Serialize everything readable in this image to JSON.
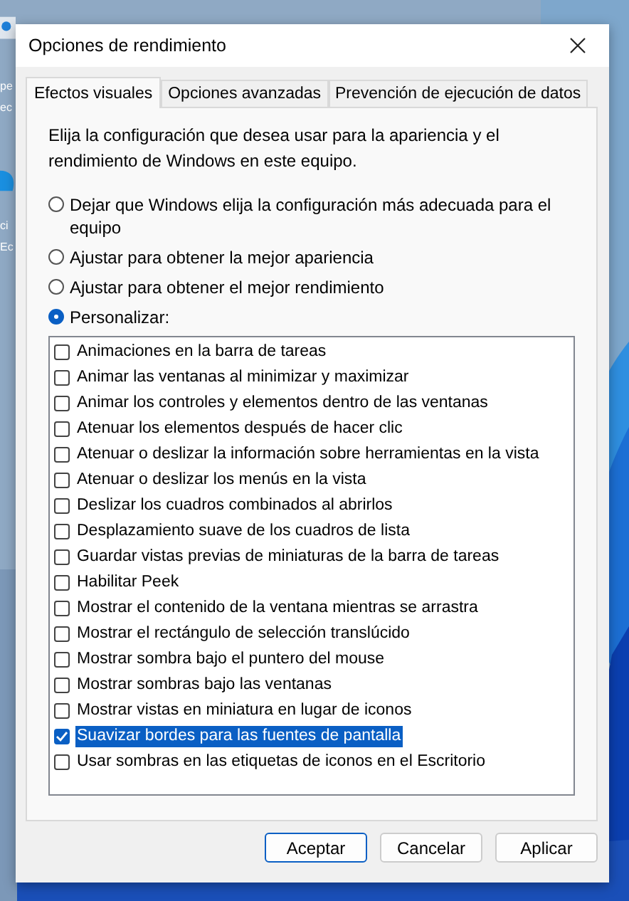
{
  "desktop_icons": [
    {
      "label_lines": [
        "pe",
        "ec"
      ]
    },
    {
      "label_lines": [
        "ci",
        "Ec"
      ]
    }
  ],
  "window": {
    "title": "Opciones de rendimiento"
  },
  "tabs": [
    {
      "label": "Efectos visuales",
      "selected": true
    },
    {
      "label": "Opciones avanzadas",
      "selected": false
    },
    {
      "label": "Prevención de ejecución de datos",
      "selected": false
    }
  ],
  "description": "Elija la configuración que desea usar para la apariencia y el rendimiento de Windows en este equipo.",
  "options": [
    {
      "label": "Dejar que Windows elija la configuración más adecuada para el equipo",
      "selected": false
    },
    {
      "label": "Ajustar para obtener la mejor apariencia",
      "selected": false
    },
    {
      "label": "Ajustar para obtener el mejor rendimiento",
      "selected": false
    },
    {
      "label": "Personalizar:",
      "selected": true
    }
  ],
  "effects": [
    {
      "label": "Animaciones en la barra de tareas",
      "checked": false,
      "selected": false
    },
    {
      "label": "Animar las ventanas al minimizar y maximizar",
      "checked": false,
      "selected": false
    },
    {
      "label": "Animar los controles y elementos dentro de las ventanas",
      "checked": false,
      "selected": false
    },
    {
      "label": "Atenuar los elementos después de hacer clic",
      "checked": false,
      "selected": false
    },
    {
      "label": "Atenuar o deslizar la información sobre herramientas en la vista",
      "checked": false,
      "selected": false
    },
    {
      "label": "Atenuar o deslizar los menús en la vista",
      "checked": false,
      "selected": false
    },
    {
      "label": "Deslizar los cuadros combinados al abrirlos",
      "checked": false,
      "selected": false
    },
    {
      "label": "Desplazamiento suave de los cuadros de lista",
      "checked": false,
      "selected": false
    },
    {
      "label": "Guardar vistas previas de miniaturas de la barra de tareas",
      "checked": false,
      "selected": false
    },
    {
      "label": "Habilitar Peek",
      "checked": false,
      "selected": false
    },
    {
      "label": "Mostrar el contenido de la ventana mientras se arrastra",
      "checked": false,
      "selected": false
    },
    {
      "label": "Mostrar el rectángulo de selección translúcido",
      "checked": false,
      "selected": false
    },
    {
      "label": "Mostrar sombra bajo el puntero del mouse",
      "checked": false,
      "selected": false
    },
    {
      "label": "Mostrar sombras bajo las ventanas",
      "checked": false,
      "selected": false
    },
    {
      "label": "Mostrar vistas en miniatura en lugar de iconos",
      "checked": false,
      "selected": false
    },
    {
      "label": "Suavizar bordes para las fuentes de pantalla",
      "checked": true,
      "selected": true
    },
    {
      "label": "Usar sombras en las etiquetas de iconos en el Escritorio",
      "checked": false,
      "selected": false
    }
  ],
  "buttons": [
    {
      "label": "Aceptar",
      "default": true
    },
    {
      "label": "Cancelar",
      "default": false
    },
    {
      "label": "Aplicar",
      "default": false
    }
  ]
}
